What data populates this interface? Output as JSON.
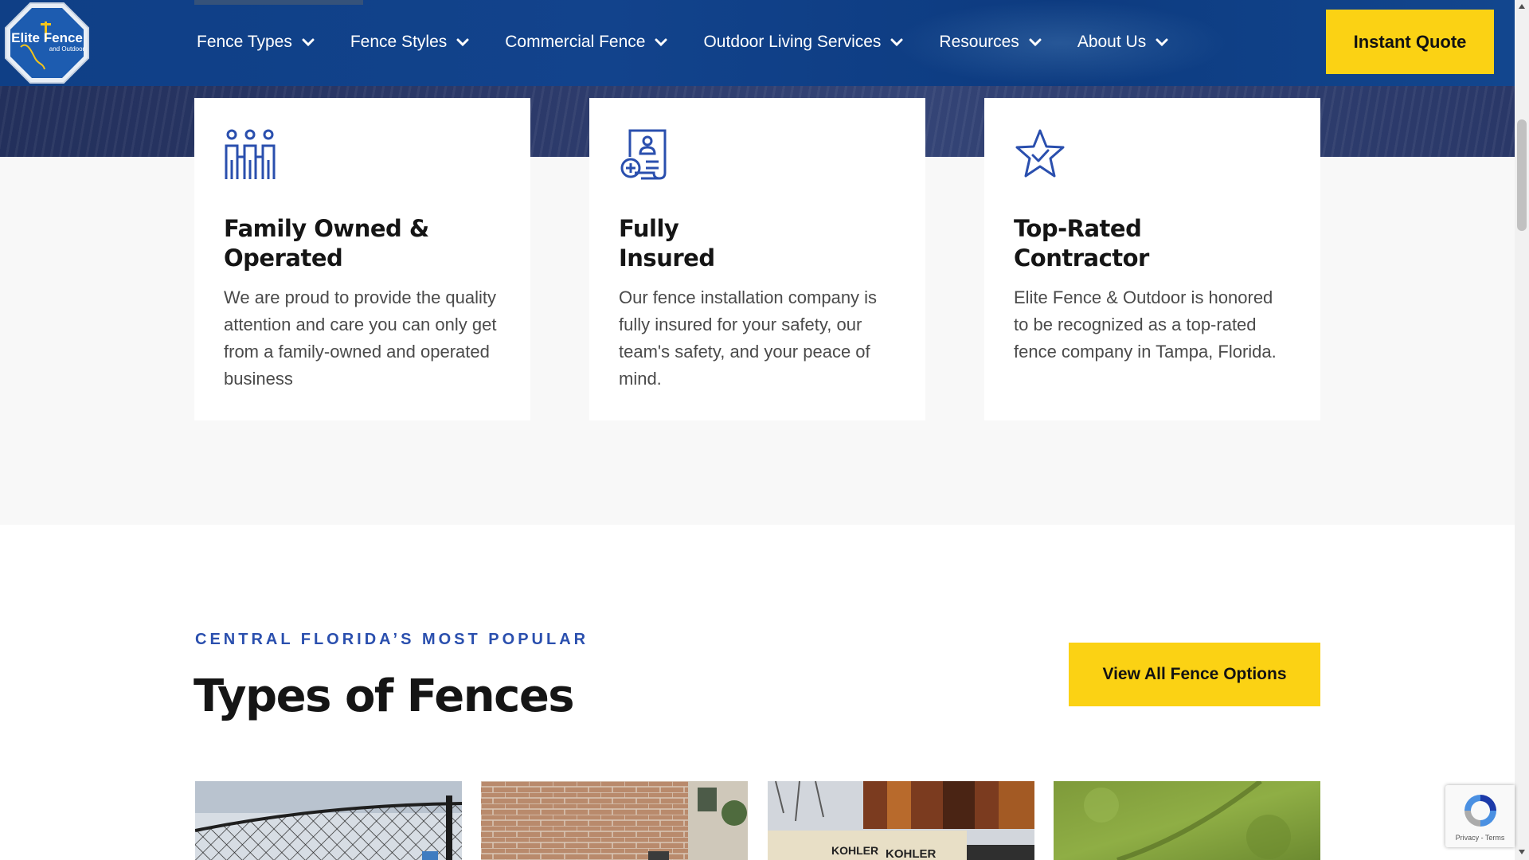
{
  "header": {
    "logo": {
      "line1": "Elite Fence",
      "line2": "and Outdoor"
    },
    "nav": [
      {
        "label": "Fence Types"
      },
      {
        "label": "Fence Styles"
      },
      {
        "label": "Commercial Fence"
      },
      {
        "label": "Outdoor Living Services"
      },
      {
        "label": "Resources"
      },
      {
        "label": "About Us"
      }
    ],
    "cta_label": "Instant Quote"
  },
  "features": [
    {
      "icon": "family-icon",
      "title": "Family Owned &\nOperated",
      "text": "We are proud to provide the quality attention and care you can only get from a family-owned and operated business"
    },
    {
      "icon": "insurance-certificate-icon",
      "title": "Fully\nInsured",
      "text": "Our fence installation company is fully insured for your safety, our team's safety, and your peace of mind."
    },
    {
      "icon": "star-check-icon",
      "title": "Top-Rated\nContractor",
      "text": "Elite Fence & Outdoor is honored to be recognized as a top-rated fence company in Tampa, Florida."
    }
  ],
  "fence_types": {
    "eyebrow": "CENTRAL FLORIDA’S MOST POPULAR",
    "title": "Types of Fences",
    "button_label": "View All Fence Options",
    "thumbnails": [
      {
        "name": "chain-link-fence-photo"
      },
      {
        "name": "brick-wall-photo"
      },
      {
        "name": "kohler-sign-fence-photo",
        "sign_text": "KOHLER"
      },
      {
        "name": "grass-lawn-photo"
      }
    ]
  },
  "recaptcha": {
    "links": "Privacy - Terms"
  },
  "colors": {
    "brand_blue": "#12438c",
    "accent_yellow": "#fbd214",
    "icon_blue": "#2a4fae"
  }
}
